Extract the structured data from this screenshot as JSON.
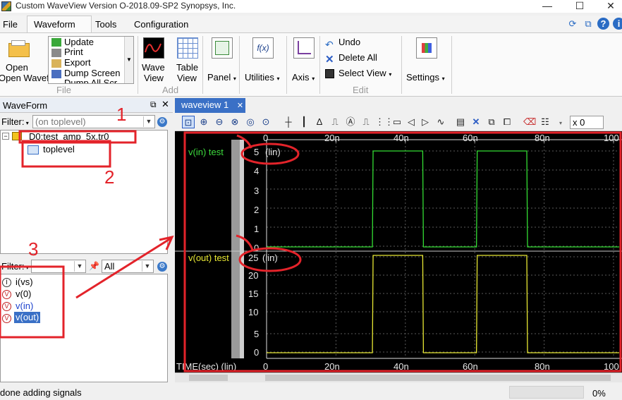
{
  "window": {
    "title": "Custom WaveView Version O-2018.09-SP2  Synopsys, Inc.",
    "controls": [
      "—",
      "☐",
      "✕"
    ]
  },
  "menu": {
    "items": [
      "File",
      "Waveform",
      "Tools",
      "Configuration"
    ],
    "active": "Waveform"
  },
  "ribbon": {
    "open_waveform": "Open Waveform",
    "file_list": [
      "Update",
      "Print",
      "Export",
      "Dump Screen",
      "Dump All Scr"
    ],
    "file_group": "File",
    "wave_view": "Wave View",
    "table_view": "Table View",
    "add_group": "Add",
    "panel": "Panel",
    "utilities": "Utilities",
    "axis": "Axis",
    "undo": "Undo",
    "delete_all": "Delete All",
    "select_view": "Select View",
    "edit_group": "Edit",
    "settings": "Settings"
  },
  "left_panel": {
    "title": "WaveForm",
    "filter_label": "Filter:",
    "filter_placeholder": "(on toplevel)",
    "tree": {
      "root": "D0:test_amp_5x.tr0",
      "child": "toplevel"
    },
    "signal_filter_label": "Filter:",
    "signal_filter_value": "All",
    "signals": [
      {
        "name": "i(vs)",
        "icon": "I"
      },
      {
        "name": "v(0)",
        "icon": "V"
      },
      {
        "name": "v(in)",
        "icon": "V"
      },
      {
        "name": "v(out)",
        "icon": "V",
        "selected": true
      }
    ]
  },
  "waveview": {
    "tab_label": "waveview 1",
    "tab_close": "✕",
    "x_field": "x 0",
    "time_label": "TIME(sec) (lin)",
    "x_ticks": [
      "0",
      "20n",
      "40n",
      "60n",
      "80n",
      "100"
    ],
    "panels": [
      {
        "name": "v(in) test",
        "scale": "(lin)",
        "yticks": [
          "5",
          "4",
          "3",
          "2",
          "1",
          "0"
        ],
        "color": "#33dd33"
      },
      {
        "name": "v(out) test",
        "scale": "(lin)",
        "yticks": [
          "25",
          "20",
          "15",
          "10",
          "5",
          "0"
        ],
        "color": "#e8e833"
      }
    ]
  },
  "annotations": [
    "1",
    "2",
    "3"
  ],
  "status": {
    "message": "done adding signals",
    "progress": "0%"
  }
}
